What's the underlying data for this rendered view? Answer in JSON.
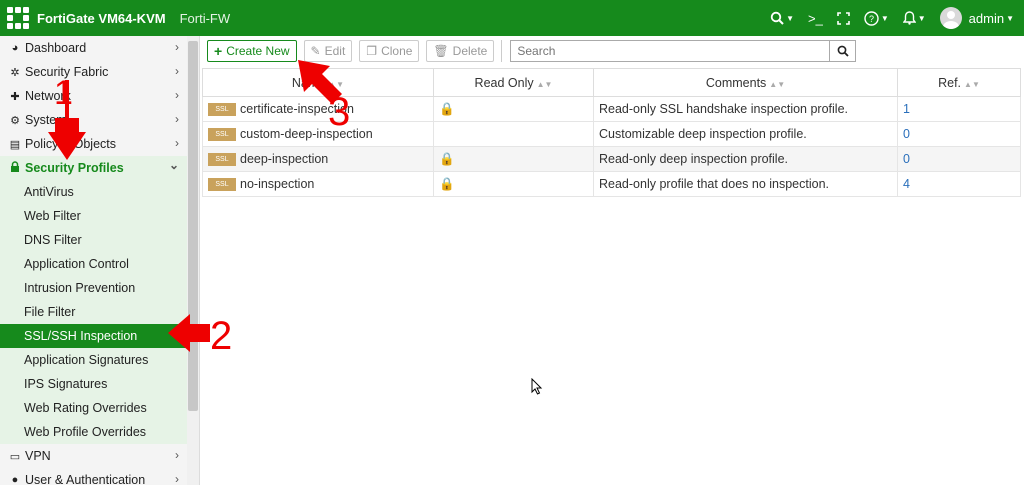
{
  "header": {
    "product": "FortiGate VM64-KVM",
    "hostname": "Forti-FW",
    "user": "admin",
    "bg_color": "#168a1c"
  },
  "sidebar": {
    "items": [
      {
        "label": "Dashboard",
        "icon": "dashboard-icon"
      },
      {
        "label": "Security Fabric",
        "icon": "fabric-icon"
      },
      {
        "label": "Network",
        "icon": "network-icon"
      },
      {
        "label": "System",
        "icon": "gear-icon"
      },
      {
        "label": "Policy & Objects",
        "icon": "policy-icon"
      },
      {
        "label": "Security Profiles",
        "icon": "lock-icon"
      },
      {
        "label": "AntiVirus"
      },
      {
        "label": "Web Filter"
      },
      {
        "label": "DNS Filter"
      },
      {
        "label": "Application Control"
      },
      {
        "label": "Intrusion Prevention"
      },
      {
        "label": "File Filter"
      },
      {
        "label": "SSL/SSH Inspection"
      },
      {
        "label": "Application Signatures"
      },
      {
        "label": "IPS Signatures"
      },
      {
        "label": "Web Rating Overrides"
      },
      {
        "label": "Web Profile Overrides"
      },
      {
        "label": "VPN",
        "icon": "laptop-icon"
      },
      {
        "label": "User & Authentication",
        "icon": "user-icon"
      }
    ]
  },
  "toolbar": {
    "create_label": "Create New",
    "edit_label": "Edit",
    "clone_label": "Clone",
    "delete_label": "Delete",
    "search_placeholder": "Search"
  },
  "table": {
    "columns": [
      "Name",
      "Read Only",
      "Comments",
      "Ref."
    ],
    "badge": "SSL",
    "rows": [
      {
        "name": "certificate-inspection",
        "read_only": true,
        "comment": "Read-only SSL handshake inspection profile.",
        "ref": "1"
      },
      {
        "name": "custom-deep-inspection",
        "read_only": false,
        "comment": "Customizable deep inspection profile.",
        "ref": "0"
      },
      {
        "name": "deep-inspection",
        "read_only": true,
        "comment": "Read-only deep inspection profile.",
        "ref": "0"
      },
      {
        "name": "no-inspection",
        "read_only": true,
        "comment": "Read-only profile that does no inspection.",
        "ref": "4"
      }
    ]
  },
  "annotations": {
    "step1": "1",
    "step2": "2",
    "step3": "3",
    "color": "#e00000"
  }
}
